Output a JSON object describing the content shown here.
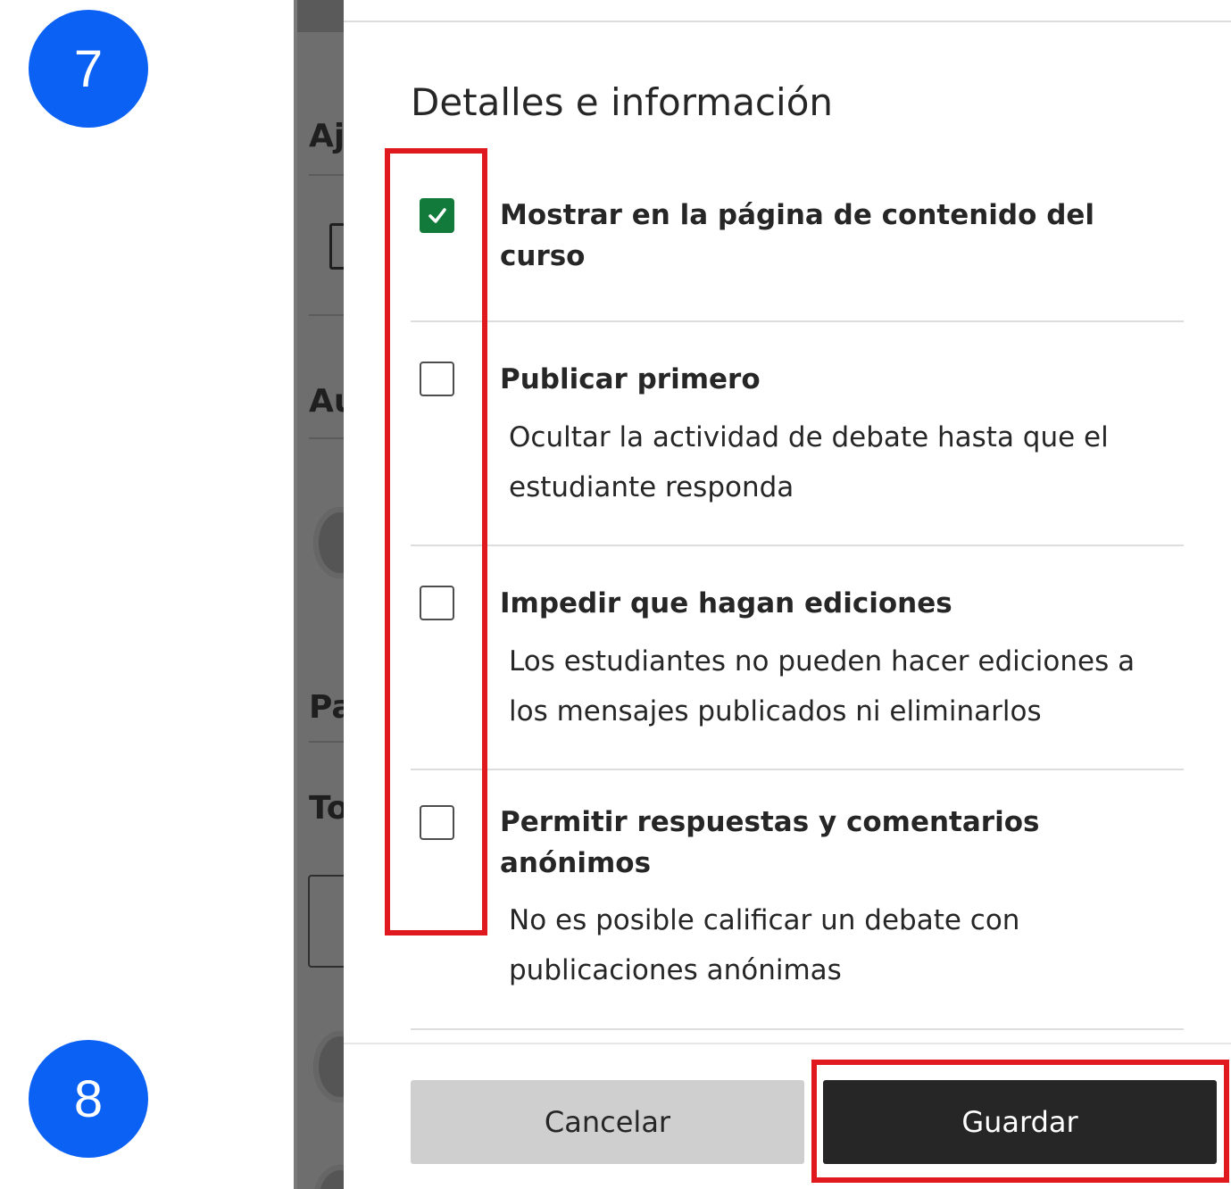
{
  "steps": {
    "step7": "7",
    "step8": "8"
  },
  "background": {
    "letters": [
      "Aj",
      "Au",
      "Pa",
      "To"
    ]
  },
  "dialog": {
    "title": "Detalles e información",
    "options": [
      {
        "label": "Mostrar en la página de contenido del curso",
        "description": "",
        "checked": true
      },
      {
        "label": "Publicar primero",
        "description": "Ocultar la actividad de debate hasta que el estudiante responda",
        "checked": false
      },
      {
        "label": "Impedir que hagan ediciones",
        "description": "Los estudiantes no pueden hacer ediciones a los mensajes publicados ni eliminarlos",
        "checked": false
      },
      {
        "label": "Permitir respuestas y comentarios anónimos",
        "description": "No es posible calificar un debate con publicaciones anónimas",
        "checked": false
      }
    ],
    "buttons": {
      "cancel": "Cancelar",
      "save": "Guardar"
    }
  },
  "colors": {
    "badge": "#0b61f3",
    "checked": "#127a3a",
    "highlight": "#e0191f",
    "save_button": "#262626",
    "cancel_button": "#cfcfcf"
  }
}
